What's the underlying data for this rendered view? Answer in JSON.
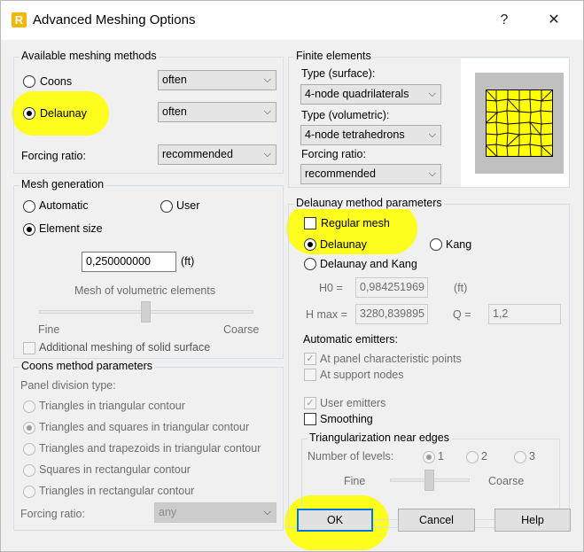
{
  "window": {
    "title": "Advanced Meshing Options",
    "app_icon_letter": "R",
    "help_glyph": "?",
    "close_glyph": "✕"
  },
  "available_methods": {
    "title": "Available meshing methods",
    "coons_label": "Coons",
    "coons_value": "often",
    "delaunay_label": "Delaunay",
    "delaunay_value": "often",
    "forcing_label": "Forcing ratio:",
    "forcing_value": "recommended"
  },
  "mesh_generation": {
    "title": "Mesh generation",
    "automatic_label": "Automatic",
    "user_label": "User",
    "element_size_label": "Element size",
    "element_size_value": "0,250000000",
    "unit": "(ft)",
    "volumetric_label": "Mesh of volumetric elements",
    "fine_label": "Fine",
    "coarse_label": "Coarse",
    "volumetric_level": 0.5,
    "additional_label": "Additional meshing of solid surface"
  },
  "coons_params": {
    "title": "Coons method parameters",
    "panel_division_label": "Panel division type:",
    "options": [
      "Triangles in triangular contour",
      "Triangles and squares in triangular contour",
      "Triangles and trapezoids in triangular contour",
      "Squares in rectangular contour",
      "Triangles in rectangular contour"
    ],
    "forcing_label": "Forcing ratio:",
    "forcing_value": "any"
  },
  "finite_elements": {
    "title": "Finite elements",
    "surface_label": "Type (surface):",
    "surface_value": "4-node quadrilaterals",
    "volumetric_label": "Type (volumetric):",
    "volumetric_value": "4-node tetrahedrons",
    "forcing_label": "Forcing ratio:",
    "forcing_value": "recommended"
  },
  "delaunay_params": {
    "title": "Delaunay method parameters",
    "regular_mesh_label": "Regular mesh",
    "delaunay_label": "Delaunay",
    "kang_label": "Kang",
    "delaunay_kang_label": "Delaunay and Kang",
    "h0_label": "H0 =",
    "h0_value": "0,984251969",
    "h0_unit": "(ft)",
    "hmax_label": "H max =",
    "hmax_value": "3280,839895",
    "q_label": "Q =",
    "q_value": "1,2",
    "auto_emitters_label": "Automatic emitters:",
    "panel_points_label": "At panel characteristic points",
    "support_nodes_label": "At support nodes",
    "user_emitters_label": "User emitters",
    "smoothing_label": "Smoothing",
    "tri_near_edges": {
      "title": "Triangularization near edges",
      "levels_label": "Number of levels:",
      "level_options": [
        "1",
        "2",
        "3"
      ],
      "fine_label": "Fine",
      "coarse_label": "Coarse",
      "level": 0.5
    }
  },
  "buttons": {
    "ok": "OK",
    "cancel": "Cancel",
    "help": "Help"
  },
  "colors": {
    "highlight": "#ffff00",
    "mesh_fill": "#ffff00",
    "preview_bg": "#c0c0c0",
    "default_button_border": "#0078d7"
  }
}
